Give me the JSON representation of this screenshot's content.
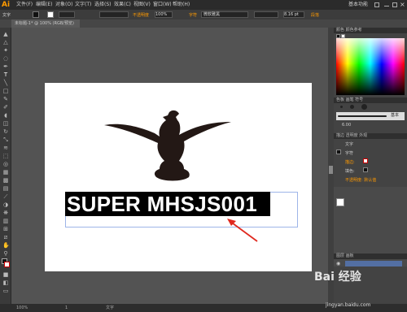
{
  "app": {
    "logo": "Ai"
  },
  "menubar": {
    "items": [
      "文件(F)",
      "编辑(E)",
      "对象(O)",
      "文字(T)",
      "选择(S)",
      "效果(C)",
      "视图(V)",
      "窗口(W)",
      "帮助(H)"
    ],
    "workspace": "基本功能"
  },
  "control_bar": {
    "label": "文字",
    "opacity_label": "不透明度",
    "opacity_value": "100%",
    "char_label": "字符",
    "font_name": "微软雅黑",
    "size_value": "8.16 pt",
    "paragraph_label": "段落"
  },
  "document_tab": {
    "label": "未标题-1* @ 100% (RGB/预览)"
  },
  "panels": {
    "color_title": "颜色  颜色参考",
    "brush_title": "色板  画笔  符号",
    "brush_size": "6.00",
    "brush_basic": "基本",
    "appearance_title": "描边  透明度  外观",
    "appearance_rows": [
      "文字",
      "字符",
      "描边:",
      "填色:",
      "不透明度: 默认值"
    ],
    "layers_title": "图层  画板"
  },
  "artwork": {
    "text": "SUPER MHSJS001"
  },
  "watermark": {
    "brand": "Bai 经验",
    "url": "jingyan.baidu.com"
  },
  "statusbar": {
    "zoom": "100%",
    "page": "1",
    "tool": "文字"
  },
  "colors": {
    "accent": "#ff9a00",
    "arrow": "#e0291f",
    "bird": "#231815"
  }
}
